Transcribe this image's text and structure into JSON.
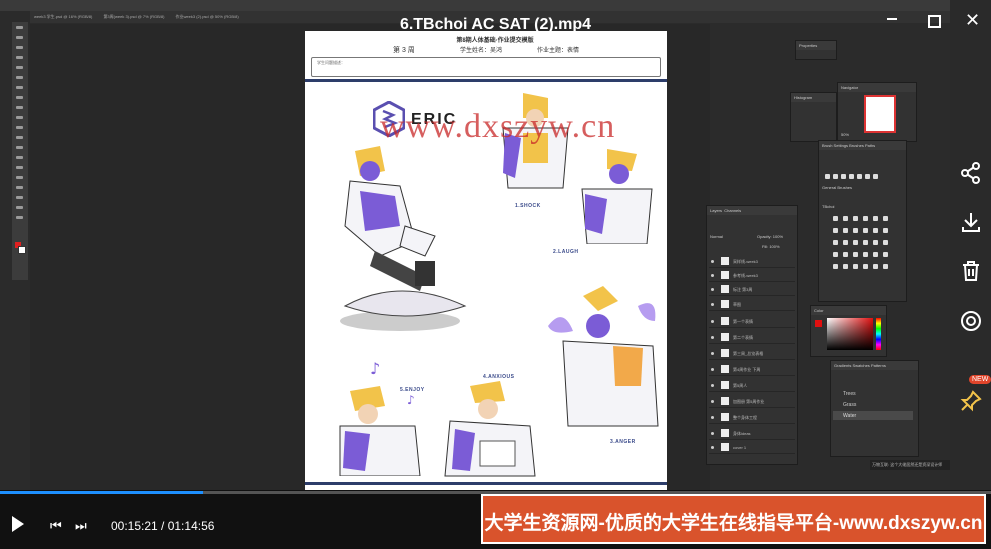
{
  "video": {
    "title": "6.TBchoi AC  SAT (2).mp4",
    "current_time": "00:15:21",
    "total_time": "01:14:56",
    "time_display": "00:15:21 / 01:14:56",
    "progress": 0.2049,
    "new_badge": "NEW"
  },
  "photoshop": {
    "tabs": [
      "week3 学生.psd @ 16% (RGB/8)",
      "第3周(week 3).psd @ 7% (RGB/8)",
      "作业week3 (2).psd @ 50% (RGB/8)"
    ],
    "panels": {
      "properties": "Properties",
      "histogram": "Histogram",
      "navigator": "Navigator",
      "brush_settings": "Brush Settings",
      "brushes": "Brushes",
      "paths": "Paths",
      "general_brushes": "General Brushes",
      "tilt_folder": "TBchoi",
      "layers": "Layers",
      "channels": "Channels",
      "blend_mode": "Normal",
      "opacity": "Opacity: 100%",
      "fill": "Fill: 100%",
      "color": "Color",
      "swatches_tabs": [
        "Gradients",
        "Swatches",
        "Patterns"
      ],
      "pattern_folders": [
        "Trees",
        "Grass",
        "Water"
      ],
      "zoom_pct": "50%",
      "notification": "万物互联: 这个大佬居然还是资深设计师"
    },
    "layers": [
      "采样线-week3",
      "参考线-week3",
      "标注 第3周",
      "草图",
      "第一个表情",
      "第二个表情",
      "第三周_总览表格",
      "第4周作业 下周",
      "第5周人",
      "加图册 第5周作业",
      "整个身体工程",
      "身体ideas",
      "cover 1"
    ]
  },
  "document": {
    "header_title": "第8期人体基础·作业提交模版",
    "week_label": "第 3 周",
    "student_label": "学生姓名：",
    "student_name": "吴鸿",
    "topic_label": "作业主题：",
    "topic_value": "表情",
    "box_label": "学生问题描述：",
    "logo_text": "ERIC",
    "labels": [
      "1.SHOCK",
      "2.LAUGH",
      "3.ANGER",
      "4.ANXIOUS",
      "5.ENJOY"
    ],
    "footer_logo": "L"
  },
  "watermark_url": "www.dxszyw.cn",
  "ad_text": "大学生资源网-优质的大学生在线指导平台-www.dxszyw.cn",
  "colors": {
    "accent_purple": "#7b5cd6",
    "hair_yellow": "#f2c34a",
    "doc_navy": "#2d3d6a",
    "ad_orange": "#d9532c",
    "progress_blue": "#1e90ff",
    "watermark_red": "#c82828"
  }
}
